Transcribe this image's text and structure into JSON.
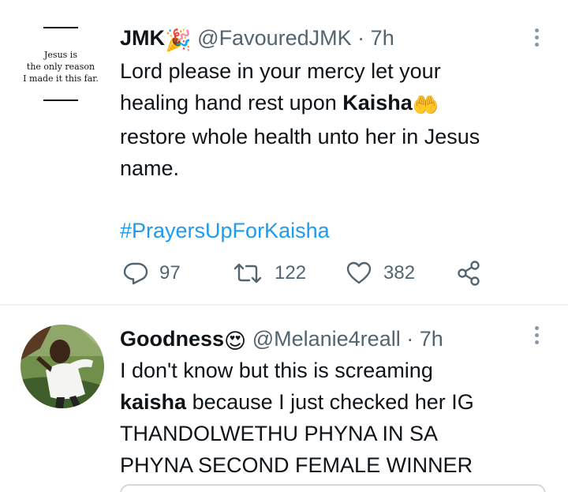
{
  "tweets": [
    {
      "author": {
        "name": "JMK",
        "name_emoji": "🎉",
        "handle": "@FavouredJMK",
        "time": "7h"
      },
      "avatar": {
        "quote_line1": "Jesus is",
        "quote_line2": "the only reason",
        "quote_line3": "I made it this far."
      },
      "body": {
        "line1": "Lord please in your mercy let your",
        "line2_a": "healing hand rest upon ",
        "line2_b": "Kaisha",
        "line2_emoji": "🤲",
        "line3": "restore whole health unto her in Jesus",
        "line4": "name."
      },
      "hashtag": "#PrayersUpForKaisha",
      "stats": {
        "replies": "97",
        "retweets": "122",
        "likes": "382"
      }
    },
    {
      "author": {
        "name": "Goodness",
        "name_emoji": "😍",
        "handle": "@Melanie4reall",
        "time": "7h"
      },
      "body": {
        "line1": "I don't know but this is screaming",
        "line2_a": "kaisha",
        "line2_b": " because I just checked her IG",
        "line3": "THANDOLWETHU PHYNA IN SA",
        "line4": "PHYNA SECOND FEMALE WINNER"
      }
    }
  ],
  "colors": {
    "link": "#1d9bf0",
    "secondary": "#536471",
    "divider": "#eff3f4"
  },
  "icons": [
    "reply-icon",
    "retweet-icon",
    "like-icon",
    "share-icon",
    "more-icon"
  ]
}
